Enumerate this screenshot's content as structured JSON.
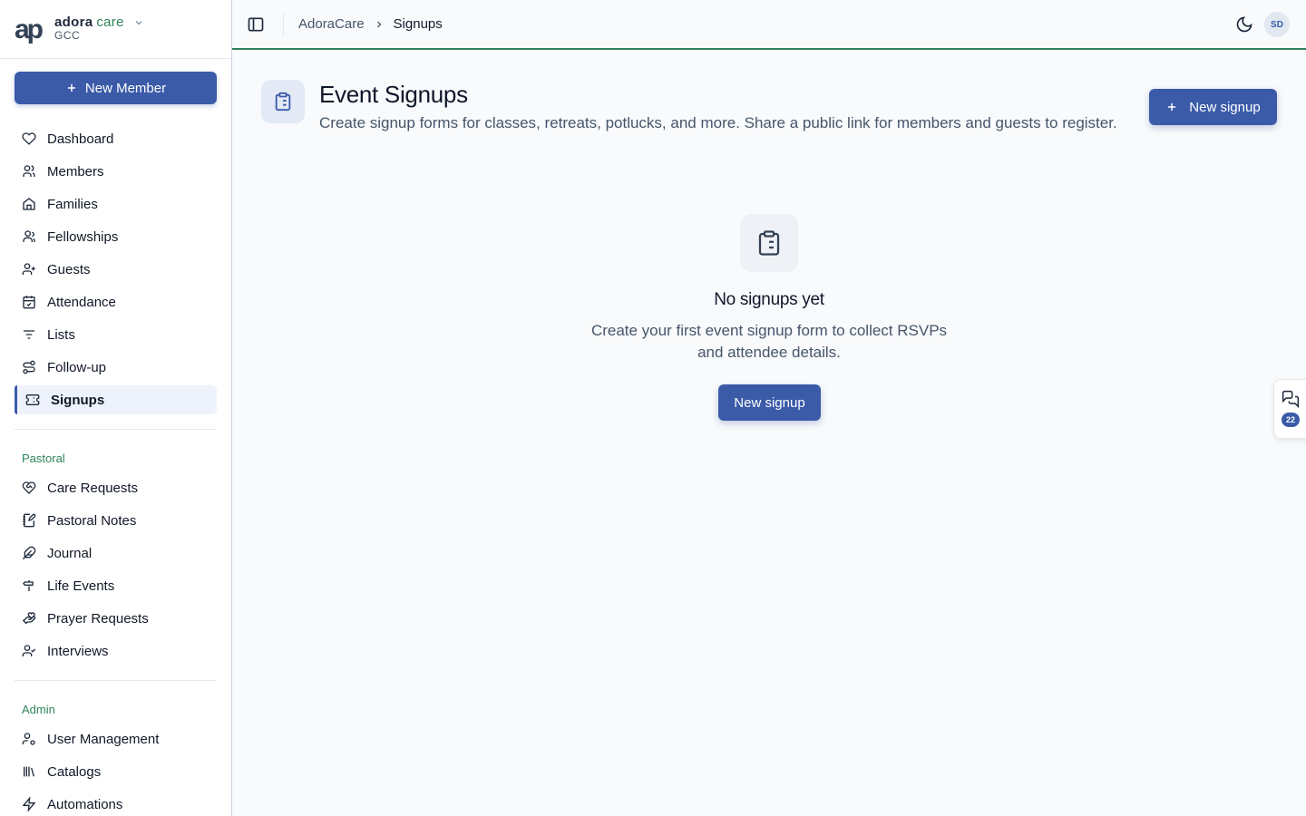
{
  "brand": {
    "name": "adora",
    "name_accent": "care",
    "org": "GCC"
  },
  "sidebar": {
    "new_member_label": "New Member",
    "main_items": [
      {
        "label": "Dashboard",
        "icon": "heart-icon"
      },
      {
        "label": "Members",
        "icon": "users-icon"
      },
      {
        "label": "Families",
        "icon": "home-icon"
      },
      {
        "label": "Fellowships",
        "icon": "group-icon"
      },
      {
        "label": "Guests",
        "icon": "user-plus-icon"
      },
      {
        "label": "Attendance",
        "icon": "calendar-check-icon"
      },
      {
        "label": "Lists",
        "icon": "filter-icon"
      },
      {
        "label": "Follow-up",
        "icon": "route-icon"
      },
      {
        "label": "Signups",
        "icon": "ticket-icon",
        "active": true
      }
    ],
    "pastoral_label": "Pastoral",
    "pastoral_items": [
      {
        "label": "Care Requests",
        "icon": "heart-handshake-icon"
      },
      {
        "label": "Pastoral Notes",
        "icon": "notebook-pen-icon"
      },
      {
        "label": "Journal",
        "icon": "feather-icon"
      },
      {
        "label": "Life Events",
        "icon": "signpost-icon"
      },
      {
        "label": "Prayer Requests",
        "icon": "hand-heart-icon"
      },
      {
        "label": "Interviews",
        "icon": "user-check-icon"
      }
    ],
    "admin_label": "Admin",
    "admin_items": [
      {
        "label": "User Management",
        "icon": "user-cog-icon"
      },
      {
        "label": "Catalogs",
        "icon": "library-icon"
      },
      {
        "label": "Automations",
        "icon": "zap-icon"
      }
    ]
  },
  "topbar": {
    "breadcrumb_root": "AdoraCare",
    "breadcrumb_current": "Signups",
    "avatar_initials": "SD"
  },
  "main": {
    "title": "Event Signups",
    "subtitle": "Create signup forms for classes, retreats, potlucks, and more. Share a public link for members and guests to register.",
    "new_signup_label": "New signup",
    "empty_title": "No signups yet",
    "empty_text": "Create your first event signup form to collect RSVPs and attendee details.",
    "empty_button_label": "New signup"
  },
  "chat_widget": {
    "badge_count": "22"
  },
  "colors": {
    "accent": "#3b5ba9",
    "section": "#2f855a",
    "topbar_border": "#2f7d5a"
  }
}
